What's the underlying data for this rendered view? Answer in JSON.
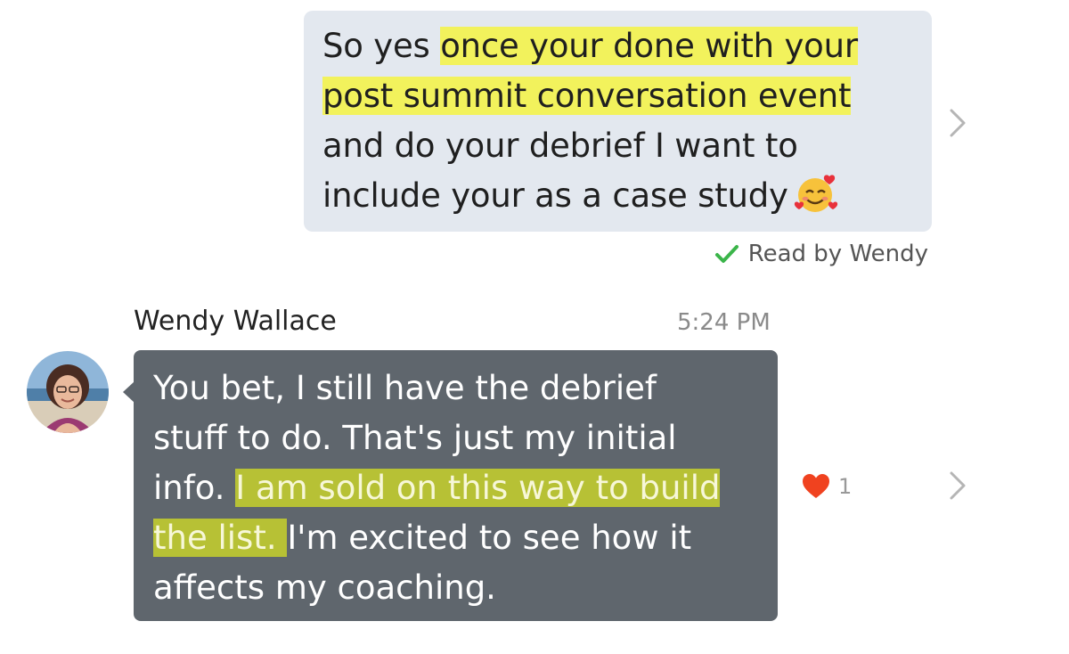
{
  "outgoing_message": {
    "text_plain_start": "So yes ",
    "text_highlight_1": "once your done with your",
    "text_highlight_2": "post summit conversation event",
    "text_rest_1": "and do your debrief I want to",
    "text_rest_2": "include your as a case study",
    "emoji_icon": "smiling-face-with-hearts-icon",
    "receipt": "Read by Wendy"
  },
  "incoming_message": {
    "sender": "Wendy Wallace",
    "time": "5:24 PM",
    "line1": "You bet, I still have the debrief",
    "line2": "stuff to do. That's just my initial",
    "line3_plain": "info. ",
    "line3_highlight": "I am sold on this way to build",
    "line4_highlight": "the list. ",
    "line4_plain": "I'm excited to see how it",
    "line5": "affects my coaching.",
    "reaction_icon": "heart-icon",
    "reaction_count": "1"
  },
  "colors": {
    "outgoing_bubble": "#e3e8ef",
    "incoming_bubble": "#5f666d",
    "highlight_outgoing": "#f2f25c",
    "highlight_incoming": "#b7c135",
    "check": "#3bb54a",
    "heart": "#f0421f"
  }
}
